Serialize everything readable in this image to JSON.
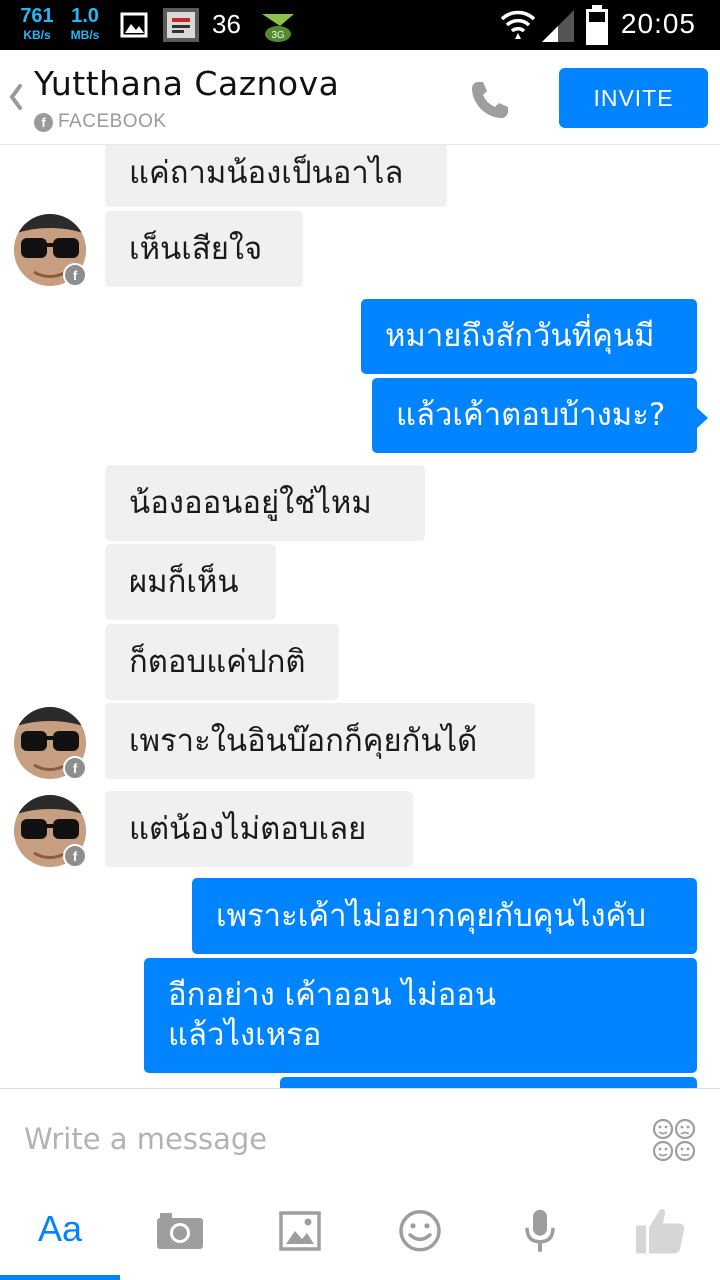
{
  "status_bar": {
    "net_up_value": "761",
    "net_up_unit": "KB/s",
    "net_down_value": "1.0",
    "net_down_unit": "MB/s",
    "notification_count": "36",
    "time": "20:05",
    "icons": [
      "image-notification-icon",
      "app-notification-icon",
      "3g-icon",
      "wifi-icon",
      "signal-icon",
      "battery-icon"
    ]
  },
  "header": {
    "contact_name": "Yutthana Caznova",
    "source_label": "FACEBOOK",
    "source_badge": "f",
    "invite_label": "INVITE",
    "accent_color": "#0084ff"
  },
  "conversation": {
    "messages": [
      {
        "direction": "incoming",
        "text": "แค่ถามน้องเป็นอาไล"
      },
      {
        "direction": "incoming",
        "text": "เห็นเสียใจ",
        "avatar": true
      },
      {
        "direction": "outgoing",
        "text": "หมายถึงสักวันที่คุนมี"
      },
      {
        "direction": "outgoing",
        "text": "แล้วเค้าตอบบ้างมะ?"
      },
      {
        "direction": "incoming",
        "text": "น้องออนอยู่ใช่ไหม"
      },
      {
        "direction": "incoming",
        "text": "ผมก็เห็น"
      },
      {
        "direction": "incoming",
        "text": "ก็ตอบแค่ปกติ"
      },
      {
        "direction": "incoming",
        "text": "เพราะในอินบ๊อกก็คุยกันได้",
        "avatar": true
      },
      {
        "direction": "incoming",
        "text": "แต่น้องไม่ตอบเลย",
        "avatar": true
      },
      {
        "direction": "outgoing",
        "text": "เพราะเค้าไม่อยากคุยกับคุนไงคับ"
      },
      {
        "direction": "outgoing",
        "text": "อีกอย่าง เค้าออน ไม่ออน",
        "text2": "แล้วไงเหรอ"
      },
      {
        "direction": "outgoing",
        "text": ""
      }
    ],
    "avatar_badge": "f",
    "incoming_bubble_color": "#f0f0f0",
    "outgoing_bubble_color": "#0084ff"
  },
  "composer": {
    "placeholder": "Write a message",
    "stickers_icon": "stickers-icon"
  },
  "toolbar": {
    "text_tab_label": "Aa",
    "icons": [
      "camera-icon",
      "gallery-icon",
      "emoji-icon",
      "microphone-icon",
      "thumbs-up-icon"
    ]
  }
}
